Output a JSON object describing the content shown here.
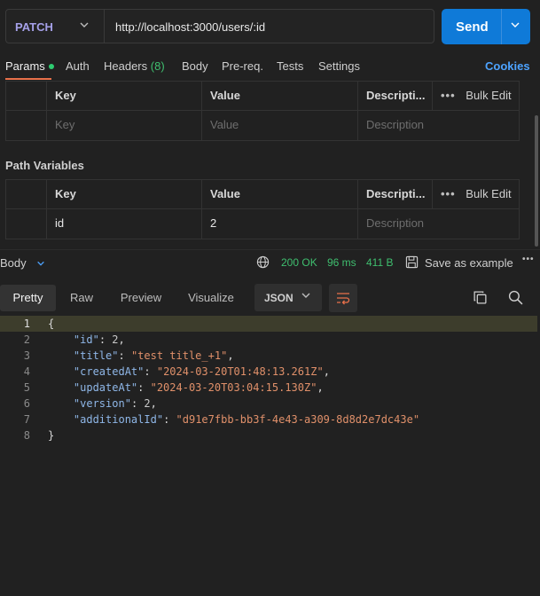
{
  "request": {
    "method": "PATCH",
    "url": "http://localhost:3000/users/:id",
    "send_label": "Send"
  },
  "tabs": {
    "params": "Params",
    "auth": "Auth",
    "headers": "Headers",
    "headers_count": "(8)",
    "body": "Body",
    "prereq": "Pre-req.",
    "tests": "Tests",
    "settings": "Settings",
    "cookies": "Cookies"
  },
  "query_table": {
    "headers": {
      "key": "Key",
      "value": "Value",
      "description": "Descripti...",
      "bulk_edit": "Bulk Edit"
    },
    "placeholder": {
      "key": "Key",
      "value": "Value",
      "description": "Description"
    }
  },
  "path_variables": {
    "title": "Path Variables",
    "headers": {
      "key": "Key",
      "value": "Value",
      "description": "Descripti...",
      "bulk_edit": "Bulk Edit"
    },
    "row": {
      "key": "id",
      "value": "2",
      "description": "Description"
    }
  },
  "response": {
    "label": "Body",
    "status": "200 OK",
    "time": "96 ms",
    "size": "411 B",
    "save_example": "Save as example",
    "view_tabs": {
      "pretty": "Pretty",
      "raw": "Raw",
      "preview": "Preview",
      "visualize": "Visualize"
    },
    "format": "JSON"
  },
  "code": {
    "line_numbers": [
      "1",
      "2",
      "3",
      "4",
      "5",
      "6",
      "7",
      "8"
    ],
    "open": "{",
    "close": "}",
    "fields": [
      {
        "key": "\"id\"",
        "value": "2",
        "type": "number",
        "comma": ","
      },
      {
        "key": "\"title\"",
        "value": "\"test title_+1\"",
        "type": "string",
        "comma": ","
      },
      {
        "key": "\"createdAt\"",
        "value": "\"2024-03-20T01:48:13.261Z\"",
        "type": "string",
        "comma": ","
      },
      {
        "key": "\"updateAt\"",
        "value": "\"2024-03-20T03:04:15.130Z\"",
        "type": "string",
        "comma": ","
      },
      {
        "key": "\"version\"",
        "value": "2",
        "type": "number",
        "comma": ","
      },
      {
        "key": "\"additionalId\"",
        "value": "\"d91e7fbb-bb3f-4e43-a309-8d8d2e7dc43e\"",
        "type": "string",
        "comma": ""
      }
    ]
  },
  "colors": {
    "accent": "#0f7ad8",
    "tab_underline": "#e8704a",
    "ok": "#3fbf6f",
    "method": "#a5a0e8"
  }
}
